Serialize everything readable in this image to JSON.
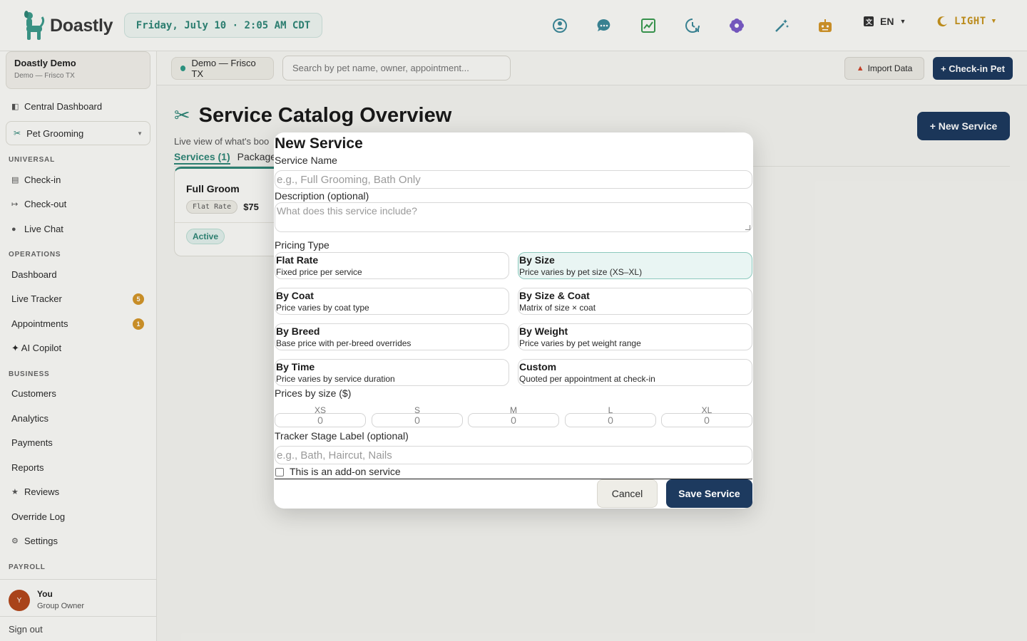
{
  "header": {
    "brand": "Doastly",
    "datetime": "Friday, July 10 · 2:05 AM CDT",
    "language": "EN",
    "theme": "LIGHT",
    "icons": [
      "person-icon",
      "chat-icon",
      "trend-chart-icon",
      "clock-chart-icon",
      "flower-icon",
      "magic-wand-icon",
      "robot-icon"
    ]
  },
  "sidebar": {
    "org_name": "Doastly Demo",
    "org_sub": "Demo — Frisco TX",
    "central_dashboard": "Central Dashboard",
    "module": "Pet Grooming",
    "sections": {
      "universal": "UNIVERSAL",
      "operations": "OPERATIONS",
      "business": "BUSINESS",
      "payroll": "PAYROLL"
    },
    "universal": [
      "Check-in",
      "Check-out",
      "Live Chat"
    ],
    "operations": [
      {
        "label": "Dashboard",
        "badge": ""
      },
      {
        "label": "Live Tracker",
        "badge": "5"
      },
      {
        "label": "Appointments",
        "badge": "1"
      },
      {
        "label": "✦ AI Copilot",
        "badge": ""
      }
    ],
    "business": [
      "Customers",
      "Analytics",
      "Payments",
      "Reports",
      "Reviews",
      "Override Log",
      "Settings"
    ],
    "user": {
      "initial": "Y",
      "name": "You",
      "role": "Group Owner"
    },
    "sign_out": "Sign out"
  },
  "subbar": {
    "location": "Demo — Frisco TX",
    "search_placeholder": "Search by pet name, owner, appointment...",
    "import_label": "Import Data",
    "checkin_label": "+ Check-in Pet"
  },
  "page": {
    "title": "Service Catalog Overview",
    "subtitle": "Live view of what's boo",
    "tabs": [
      "Services (1)",
      "Packages"
    ],
    "new_service_label": "+ New Service",
    "card": {
      "name": "Full Groom",
      "pricing": "Flat Rate",
      "price": "$75",
      "status": "Active"
    }
  },
  "modal": {
    "title": "New Service",
    "service_name_label": "Service Name",
    "service_name_placeholder": "e.g., Full Grooming, Bath Only",
    "description_label": "Description (optional)",
    "description_placeholder": "What does this service include?",
    "pricing_type_label": "Pricing Type",
    "pricing_types": [
      {
        "title": "Flat Rate",
        "desc": "Fixed price per service"
      },
      {
        "title": "By Size",
        "desc": "Price varies by pet size (XS–XL)"
      },
      {
        "title": "By Coat",
        "desc": "Price varies by coat type"
      },
      {
        "title": "By Size & Coat",
        "desc": "Matrix of size × coat"
      },
      {
        "title": "By Breed",
        "desc": "Base price with per-breed overrides"
      },
      {
        "title": "By Weight",
        "desc": "Price varies by pet weight range"
      },
      {
        "title": "By Time",
        "desc": "Price varies by service duration"
      },
      {
        "title": "Custom",
        "desc": "Quoted per appointment at check-in"
      }
    ],
    "selected_pricing": "By Size",
    "prices_label": "Prices by size ($)",
    "sizes": [
      {
        "label": "XS",
        "value": "0"
      },
      {
        "label": "S",
        "value": "0"
      },
      {
        "label": "M",
        "value": "0"
      },
      {
        "label": "L",
        "value": "0"
      },
      {
        "label": "XL",
        "value": "0"
      }
    ],
    "tracker_label": "Tracker Stage Label (optional)",
    "tracker_placeholder": "e.g., Bath, Haircut, Nails",
    "addon_label": "This is an add-on service",
    "cancel_label": "Cancel",
    "save_label": "Save Service"
  },
  "colors": {
    "accent_teal": "#2f8677",
    "navy_button": "#1d3a5f",
    "badge_orange": "#d4962a",
    "avatar": "#b4481c"
  }
}
